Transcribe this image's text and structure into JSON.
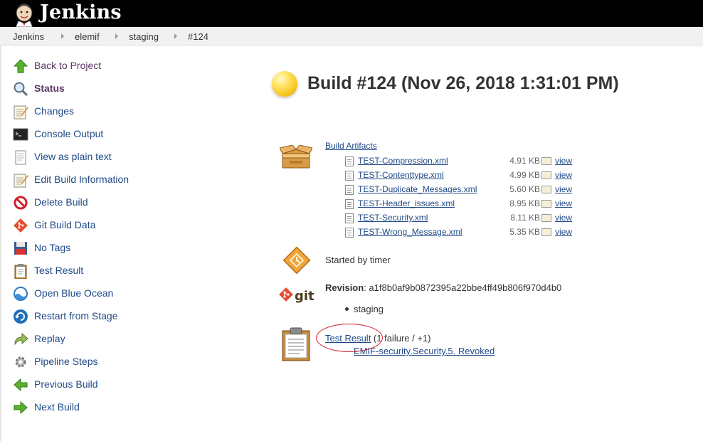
{
  "header": {
    "brand": "Jenkins"
  },
  "breadcrumb": {
    "items": [
      "Jenkins",
      "elemif",
      "staging",
      "#124"
    ]
  },
  "sidebar": {
    "items": [
      {
        "label": "Back to Project",
        "icon": "up-arrow-icon"
      },
      {
        "label": "Status",
        "icon": "magnifier-icon"
      },
      {
        "label": "Changes",
        "icon": "notepad-icon"
      },
      {
        "label": "Console Output",
        "icon": "terminal-icon"
      },
      {
        "label": "View as plain text",
        "icon": "document-icon"
      },
      {
        "label": "Edit Build Information",
        "icon": "notepad-icon"
      },
      {
        "label": "Delete Build",
        "icon": "no-entry-icon"
      },
      {
        "label": "Git Build Data",
        "icon": "git-icon"
      },
      {
        "label": "No Tags",
        "icon": "save-icon"
      },
      {
        "label": "Test Result",
        "icon": "clipboard-icon"
      },
      {
        "label": "Open Blue Ocean",
        "icon": "blue-ocean-icon"
      },
      {
        "label": "Restart from Stage",
        "icon": "restart-icon"
      },
      {
        "label": "Replay",
        "icon": "replay-icon"
      },
      {
        "label": "Pipeline Steps",
        "icon": "gear-icon"
      },
      {
        "label": "Previous Build",
        "icon": "left-arrow-icon"
      },
      {
        "label": "Next Build",
        "icon": "right-arrow-icon"
      }
    ]
  },
  "main": {
    "build_title": "Build #124 (Nov 26, 2018 1:31:01 PM)",
    "status_color": "#f6c31a",
    "artifacts": {
      "heading": "Build Artifacts",
      "view_label": "view",
      "files": [
        {
          "name": "TEST-Compression.xml",
          "size": "4.91 KB"
        },
        {
          "name": "TEST-Contenttype.xml",
          "size": "4.99 KB"
        },
        {
          "name": "TEST-Duplicate_Messages.xml",
          "size": "5.60 KB"
        },
        {
          "name": "TEST-Header_issues.xml",
          "size": "8.95 KB"
        },
        {
          "name": "TEST-Security.xml",
          "size": "8.11 KB"
        },
        {
          "name": "TEST-Wrong_Message.xml",
          "size": "5.35 KB"
        }
      ]
    },
    "started_by": "Started by timer",
    "git": {
      "logo_text": "git",
      "revision_label": "Revision",
      "revision_value": ": a1f8b0af9b0872395a22bbe4ff49b806f970d4b0",
      "branch": "staging"
    },
    "test_result": {
      "link": "Test Result",
      "summary": " (1 failure / +1)",
      "failed_test": "EMIF-security.Security.5. Revoked"
    }
  }
}
